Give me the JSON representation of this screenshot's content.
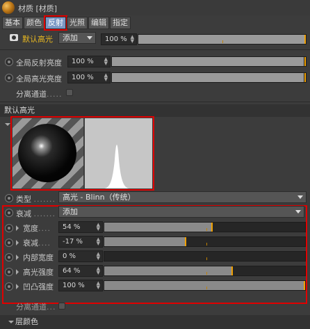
{
  "window": {
    "title": "材质 [材质]"
  },
  "tabs": [
    {
      "label": "基本"
    },
    {
      "label": "颜色"
    },
    {
      "label": "反射"
    },
    {
      "label": "光照"
    },
    {
      "label": "编辑"
    },
    {
      "label": "指定"
    }
  ],
  "layer_bar": {
    "name": "默认高光",
    "add_label": "添加",
    "value": "100 %",
    "fill_percent": 100
  },
  "global": {
    "reflect_label": "全局反射亮度",
    "reflect_value": "100 %",
    "specular_label": "全局高光亮度",
    "specular_value": "100 %",
    "separate_label": "分离通道",
    "separate_dots": "....."
  },
  "section": {
    "title": "默认高光"
  },
  "type_row": {
    "label": "类型",
    "dots": ".......",
    "value": "高光 - Blinn（传统）"
  },
  "attenuation_row": {
    "label": "衰减",
    "dots": ".......",
    "value": "添加"
  },
  "params": [
    {
      "label": "宽度",
      "dots": "....",
      "value": "54 %",
      "fill": 54
    },
    {
      "label": "衰减",
      "dots": "....",
      "value": "-17 %",
      "fill": 41
    },
    {
      "label": "内部宽度",
      "dots": "",
      "value": "0 %",
      "fill": 0
    },
    {
      "label": "高光强度",
      "dots": "",
      "value": "64 %",
      "fill": 64
    },
    {
      "label": "凹凸强度",
      "dots": "",
      "value": "100 %",
      "fill": 100
    }
  ],
  "bottom": {
    "separate_label": "分离通道",
    "separate_dots": "...",
    "layer_color_label": "层颜色"
  },
  "colors": {
    "accent": "#f0a000",
    "highlight_box": "#e00000",
    "active_tab": "#7a97c4"
  }
}
